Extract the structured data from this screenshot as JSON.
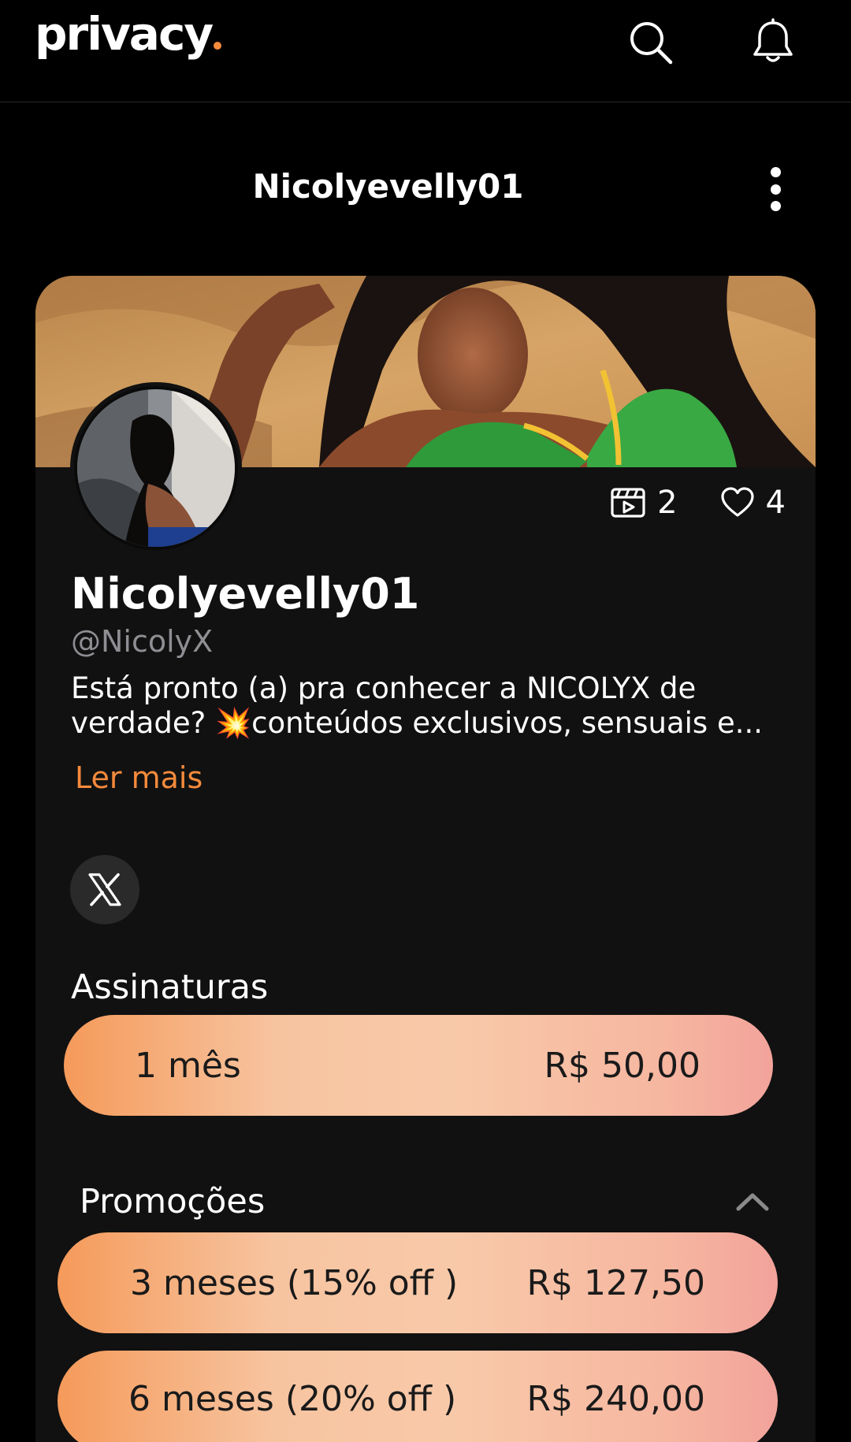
{
  "app": {
    "logo_text": "privacy",
    "accent": "#f58a3c"
  },
  "header": {
    "search_icon": "search-icon",
    "bell_icon": "bell-icon"
  },
  "profile_header": {
    "title": "Nicolyevelly01",
    "menu_icon": "more-vertical-icon"
  },
  "profile": {
    "stats": {
      "media_count": "2",
      "likes_count": "4"
    },
    "display_name": "Nicolyevelly01",
    "handle": "@NicolyX",
    "bio_line1": "Está pronto (a) pra conhecer a NICOLYX de",
    "bio_line2_prefix": "verdade? ",
    "bio_emoji": "💥",
    "bio_line2_rest": "conteúdos exclusivos, sensuais e...",
    "read_more": "Ler mais",
    "social_icon": "x-twitter-icon"
  },
  "subscriptions": {
    "title": "Assinaturas",
    "plans": [
      {
        "label": "1 mês",
        "price": "R$ 50,00"
      }
    ]
  },
  "promotions": {
    "title": "Promoções",
    "plans": [
      {
        "label": "3 meses (15% off )",
        "price": "R$ 127,50"
      },
      {
        "label": "6 meses (20% off )",
        "price": "R$ 240,00"
      }
    ]
  }
}
